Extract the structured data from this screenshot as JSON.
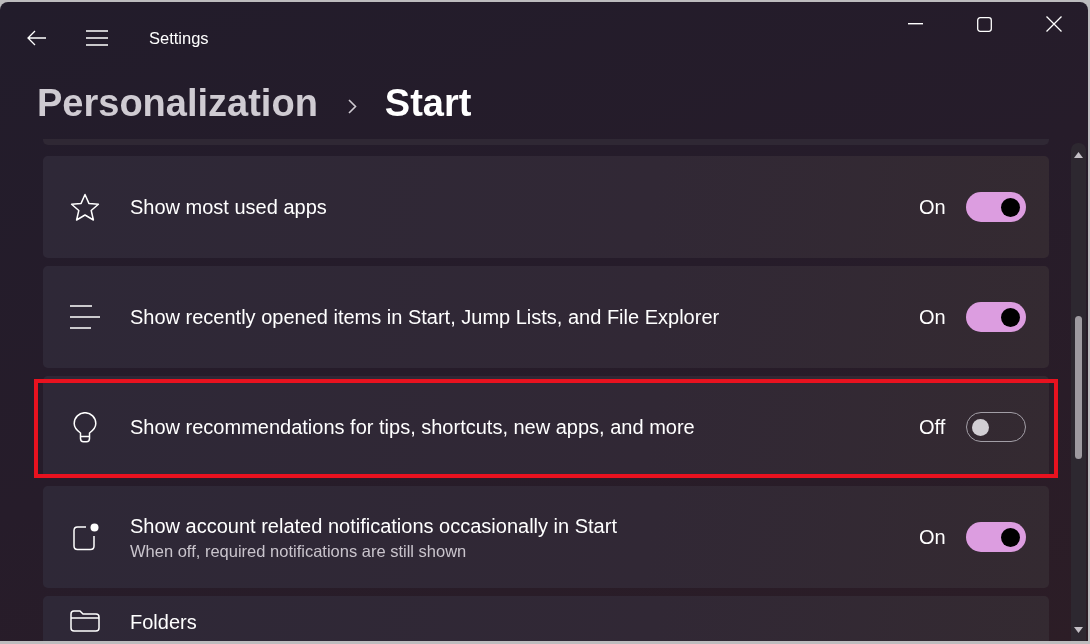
{
  "window": {
    "title": "Settings"
  },
  "breadcrumb": [
    {
      "label": "Personalization",
      "current": false
    },
    {
      "label": "Start",
      "current": true
    }
  ],
  "settings": [
    {
      "kind": "toggle",
      "label": "Show most used apps",
      "state_label": "On",
      "on": true,
      "highlighted": false
    },
    {
      "kind": "toggle",
      "label": "Show recently opened items in Start, Jump Lists, and File Explorer",
      "state_label": "On",
      "on": true,
      "highlighted": false
    },
    {
      "kind": "toggle",
      "label": "Show recommendations for tips, shortcuts, new apps, and more",
      "state_label": "Off",
      "on": false,
      "highlighted": true
    },
    {
      "kind": "toggle",
      "label": "Show account related notifications occasionally in Start",
      "description": "When off, required notifications are still shown",
      "state_label": "On",
      "on": true,
      "highlighted": false
    },
    {
      "kind": "link",
      "label": "Folders"
    }
  ]
}
